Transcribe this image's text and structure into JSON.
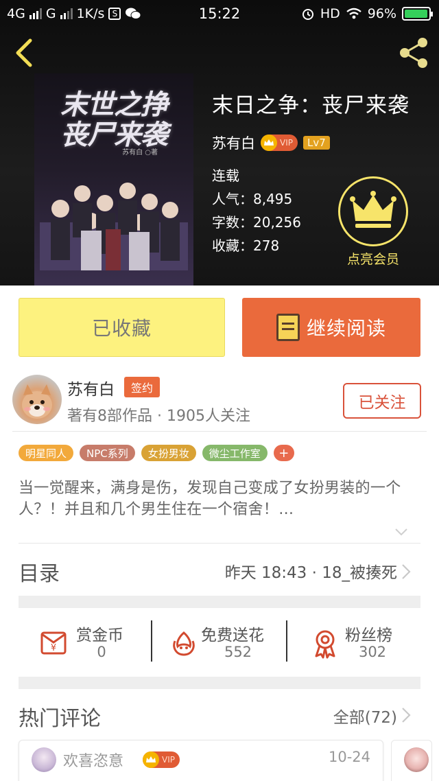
{
  "status_bar": {
    "network1": "4G",
    "network2": "G",
    "speed": "1K/s",
    "time": "15:22",
    "hd": "HD",
    "battery": "96%",
    "battery_level": 0.96,
    "icons": [
      "signal-icon",
      "s-app-icon",
      "wechat-icon",
      "alarm-icon",
      "wifi-icon",
      "battery-icon"
    ]
  },
  "header": {
    "back_icon": "chevron-left-icon",
    "share_icon": "share-icon"
  },
  "book": {
    "cover_title": "末世之挣\n丧尸来袭",
    "cover_byline": "苏有白 ○著",
    "title": "末日之争：丧尸来袭",
    "author": "苏有白",
    "vip": "VIP",
    "level": "Lv7",
    "status": "连载",
    "popularity": "人气：8,495",
    "word_count": "字数：20,256",
    "favorites": "收藏：278"
  },
  "member": {
    "label": "点亮会员",
    "icon": "crown-icon"
  },
  "actions": {
    "collected": "已收藏",
    "continue": "继续阅读"
  },
  "author_row": {
    "name": "苏有白",
    "sign_badge": "签约",
    "works": "著有8部作品 · 1905人关注",
    "follow_button": "已关注"
  },
  "tags": [
    {
      "label": "明星同人",
      "color": "#f2a93b"
    },
    {
      "label": "NPC系列",
      "color": "#c77c6a"
    },
    {
      "label": "女扮男妆",
      "color": "#d9a235"
    },
    {
      "label": "微尘工作室",
      "color": "#86b86a"
    },
    {
      "label": "+",
      "color": "#e86a4d"
    }
  ],
  "description": "当一觉醒来，满身是伤，发现自己变成了女扮男装的一个人？！并且和几个男生住在一个宿舍！…",
  "toc": {
    "title": "目录",
    "latest": "昨天 18:43 · 18_被揍死"
  },
  "stats": [
    {
      "label": "赏金币",
      "value": "0",
      "icon": "red-envelope-icon"
    },
    {
      "label": "免费送花",
      "value": "552",
      "icon": "flower-icon"
    },
    {
      "label": "粉丝榜",
      "value": "302",
      "icon": "ribbon-medal-icon"
    }
  ],
  "comments": {
    "title": "热门评论",
    "all": "全部(72)",
    "first": {
      "user": "欢喜恣意",
      "vip": "VIP",
      "date": "10-24"
    }
  }
}
